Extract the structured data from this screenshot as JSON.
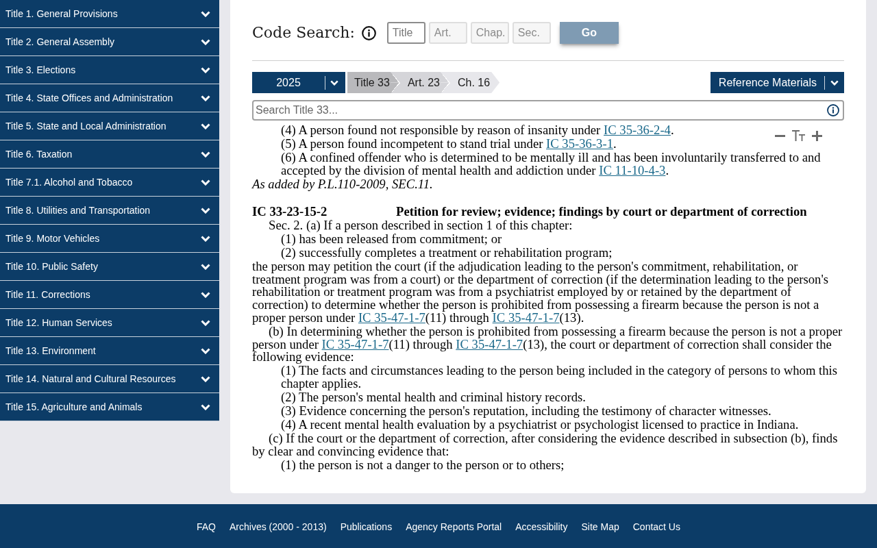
{
  "sidebar": {
    "items": [
      {
        "label": "Title 1. General Provisions",
        "expanded": false
      },
      {
        "label": "Title 2. General Assembly",
        "expanded": false
      },
      {
        "label": "Title 3. Elections",
        "expanded": false
      },
      {
        "label": "Title 4. State Offices and Administration",
        "expanded": false
      },
      {
        "label": "Title 5. State and Local Administration",
        "expanded": false
      },
      {
        "label": "Title 6. Taxation",
        "expanded": false
      },
      {
        "label": "Title 7.1. Alcohol and Tobacco",
        "expanded": false
      },
      {
        "label": "Title 8. Utilities and Transportation",
        "expanded": false
      },
      {
        "label": "Title 9. Motor Vehicles",
        "expanded": false
      },
      {
        "label": "Title 10. Public Safety",
        "expanded": false
      },
      {
        "label": "Title 11. Corrections",
        "expanded": false
      },
      {
        "label": "Title 12. Human Services",
        "expanded": false
      },
      {
        "label": "Title 13. Environment",
        "expanded": false
      },
      {
        "label": "Title 14. Natural and Cultural Resources",
        "expanded": false
      },
      {
        "label": "Title 15. Agriculture and Animals",
        "expanded": false
      }
    ]
  },
  "code_search": {
    "title": "Code Search:",
    "fields": [
      {
        "placeholder": "Title",
        "disabled": false
      },
      {
        "placeholder": "Art.",
        "disabled": true
      },
      {
        "placeholder": "Chap.",
        "disabled": true
      },
      {
        "placeholder": "Sec.",
        "disabled": true
      }
    ],
    "go_button": "Go"
  },
  "breadcrumb": {
    "year": "2025",
    "crumbs": [
      "Title 33",
      "Art. 23",
      "Ch. 16"
    ],
    "reference_menu": "Reference Materials"
  },
  "search": {
    "placeholder": "Search Title 33..."
  },
  "document": {
    "blocks": [
      {
        "kind": "item",
        "parts": [
          {
            "kind": "text",
            "text": "(4) A person found not responsible by reason of insanity under "
          },
          {
            "kind": "link",
            "text": "IC 35-36-2-4"
          },
          {
            "kind": "text",
            "text": "."
          }
        ]
      },
      {
        "kind": "item",
        "parts": [
          {
            "kind": "text",
            "text": "(5) A person found incompetent to stand trial under "
          },
          {
            "kind": "link",
            "text": "IC 35-36-3-1"
          },
          {
            "kind": "text",
            "text": "."
          }
        ]
      },
      {
        "kind": "item",
        "parts": [
          {
            "kind": "text",
            "text": "(6) A confined offender who is determined to be mentally ill and has been involuntarily transferred to and accepted by the division of mental health and addiction under "
          },
          {
            "kind": "link",
            "text": "IC 11-10-4-3"
          },
          {
            "kind": "text",
            "text": "."
          }
        ]
      },
      {
        "kind": "history",
        "parts": [
          {
            "kind": "text",
            "text": "As added by P.L.110-2009, SEC.11."
          }
        ]
      },
      {
        "kind": "heading",
        "number": "IC 33-23-15-2",
        "title": "Petition for review; evidence; findings by court or department of correction"
      },
      {
        "kind": "sec",
        "parts": [
          {
            "kind": "text",
            "text": "Sec. 2. (a) If a person described in section 1 of this chapter:"
          }
        ]
      },
      {
        "kind": "item",
        "parts": [
          {
            "kind": "text",
            "text": "(1) has been released from commitment; or"
          }
        ]
      },
      {
        "kind": "item",
        "parts": [
          {
            "kind": "text",
            "text": "(2) successfully completes a treatment or rehabilitation program;"
          }
        ]
      },
      {
        "kind": "plain",
        "parts": [
          {
            "kind": "text",
            "text": "the person may petition the court (if the adjudication leading to the person's commitment, rehabilitation, or treatment program was from a court) or the department of correction (if the determination leading to the person's rehabilitation or treatment program was from a psychiatrist employed by or retained by the department of correction) to determine whether the person is prohibited from possessing a firearm because the person is not a proper person under "
          },
          {
            "kind": "link",
            "text": "IC 35-47-1-7"
          },
          {
            "kind": "text",
            "text": "(11) through "
          },
          {
            "kind": "link",
            "text": "IC 35-47-1-7"
          },
          {
            "kind": "text",
            "text": "(13)."
          }
        ]
      },
      {
        "kind": "sec",
        "parts": [
          {
            "kind": "text",
            "text": "(b) In determining whether the person is prohibited from possessing a firearm because the person is not a proper person under "
          },
          {
            "kind": "link",
            "text": "IC 35-47-1-7"
          },
          {
            "kind": "text",
            "text": "(11) through "
          },
          {
            "kind": "link",
            "text": "IC 35-47-1-7"
          },
          {
            "kind": "text",
            "text": "(13), the court or department of correction shall consider the following evidence:"
          }
        ]
      },
      {
        "kind": "item",
        "parts": [
          {
            "kind": "text",
            "text": "(1) The facts and circumstances leading to the person being included in the category of persons to whom this chapter applies."
          }
        ]
      },
      {
        "kind": "item",
        "parts": [
          {
            "kind": "text",
            "text": "(2) The person's mental health and criminal history records."
          }
        ]
      },
      {
        "kind": "item",
        "parts": [
          {
            "kind": "text",
            "text": "(3) Evidence concerning the person's reputation, including the testimony of character witnesses."
          }
        ]
      },
      {
        "kind": "item",
        "parts": [
          {
            "kind": "text",
            "text": "(4) A recent mental health evaluation by a psychiatrist or psychologist licensed to practice in Indiana."
          }
        ]
      },
      {
        "kind": "sec",
        "parts": [
          {
            "kind": "text",
            "text": "(c) If the court or the department of correction, after considering the evidence described in subsection (b), finds by clear and convincing evidence that:"
          }
        ]
      },
      {
        "kind": "item",
        "parts": [
          {
            "kind": "text",
            "text": "(1) the person is not a danger to the person or to others;"
          }
        ]
      }
    ]
  },
  "footer": {
    "links": [
      "FAQ",
      "Archives (2000 - 2013)",
      "Publications",
      "Agency Reports Portal",
      "Accessibility",
      "Site Map",
      "Contact Us"
    ]
  }
}
